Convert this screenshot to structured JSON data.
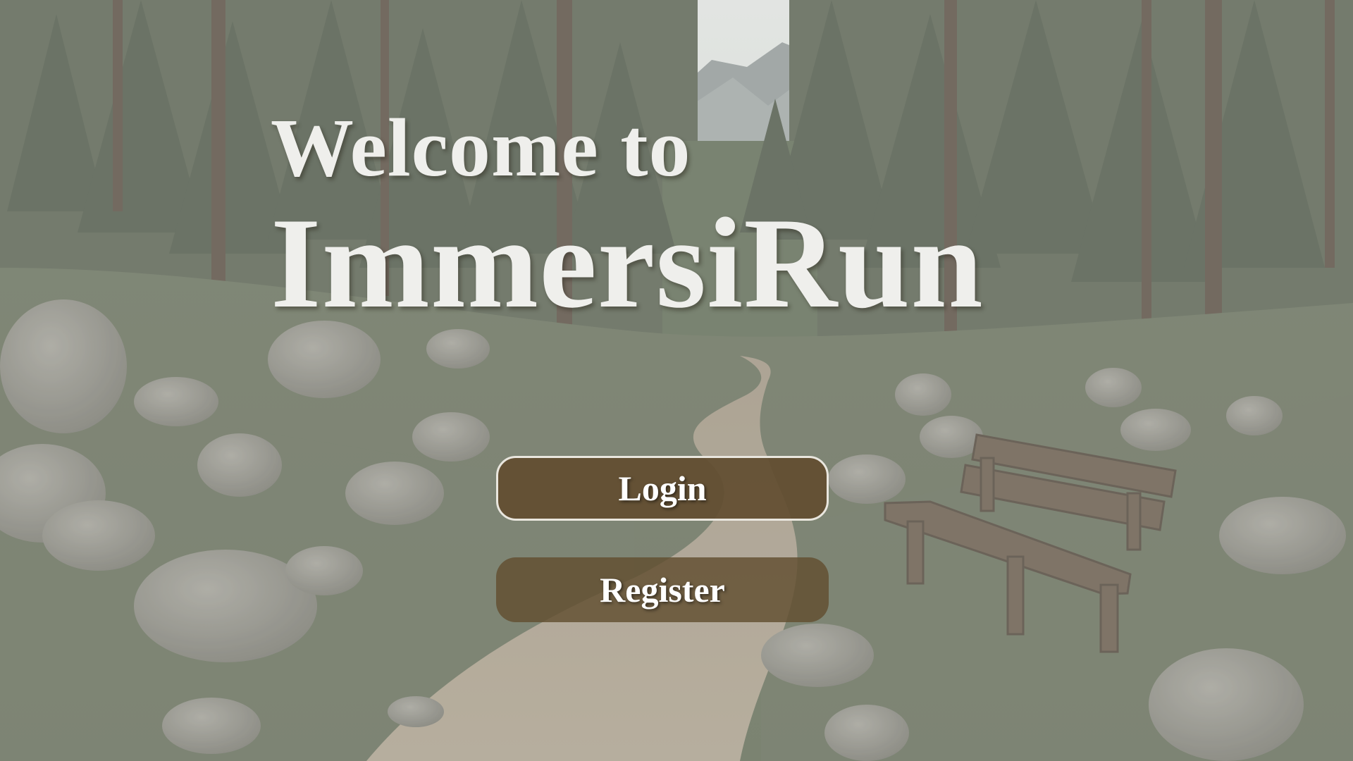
{
  "hero": {
    "line1": "Welcome to",
    "line2": "ImmersiRun"
  },
  "buttons": {
    "login_label": "Login",
    "register_label": "Register"
  },
  "colors": {
    "button_fill": "#624e30",
    "button_border": "#e9e6de",
    "title_text": "#efefec",
    "forest": "#4f5a46"
  }
}
